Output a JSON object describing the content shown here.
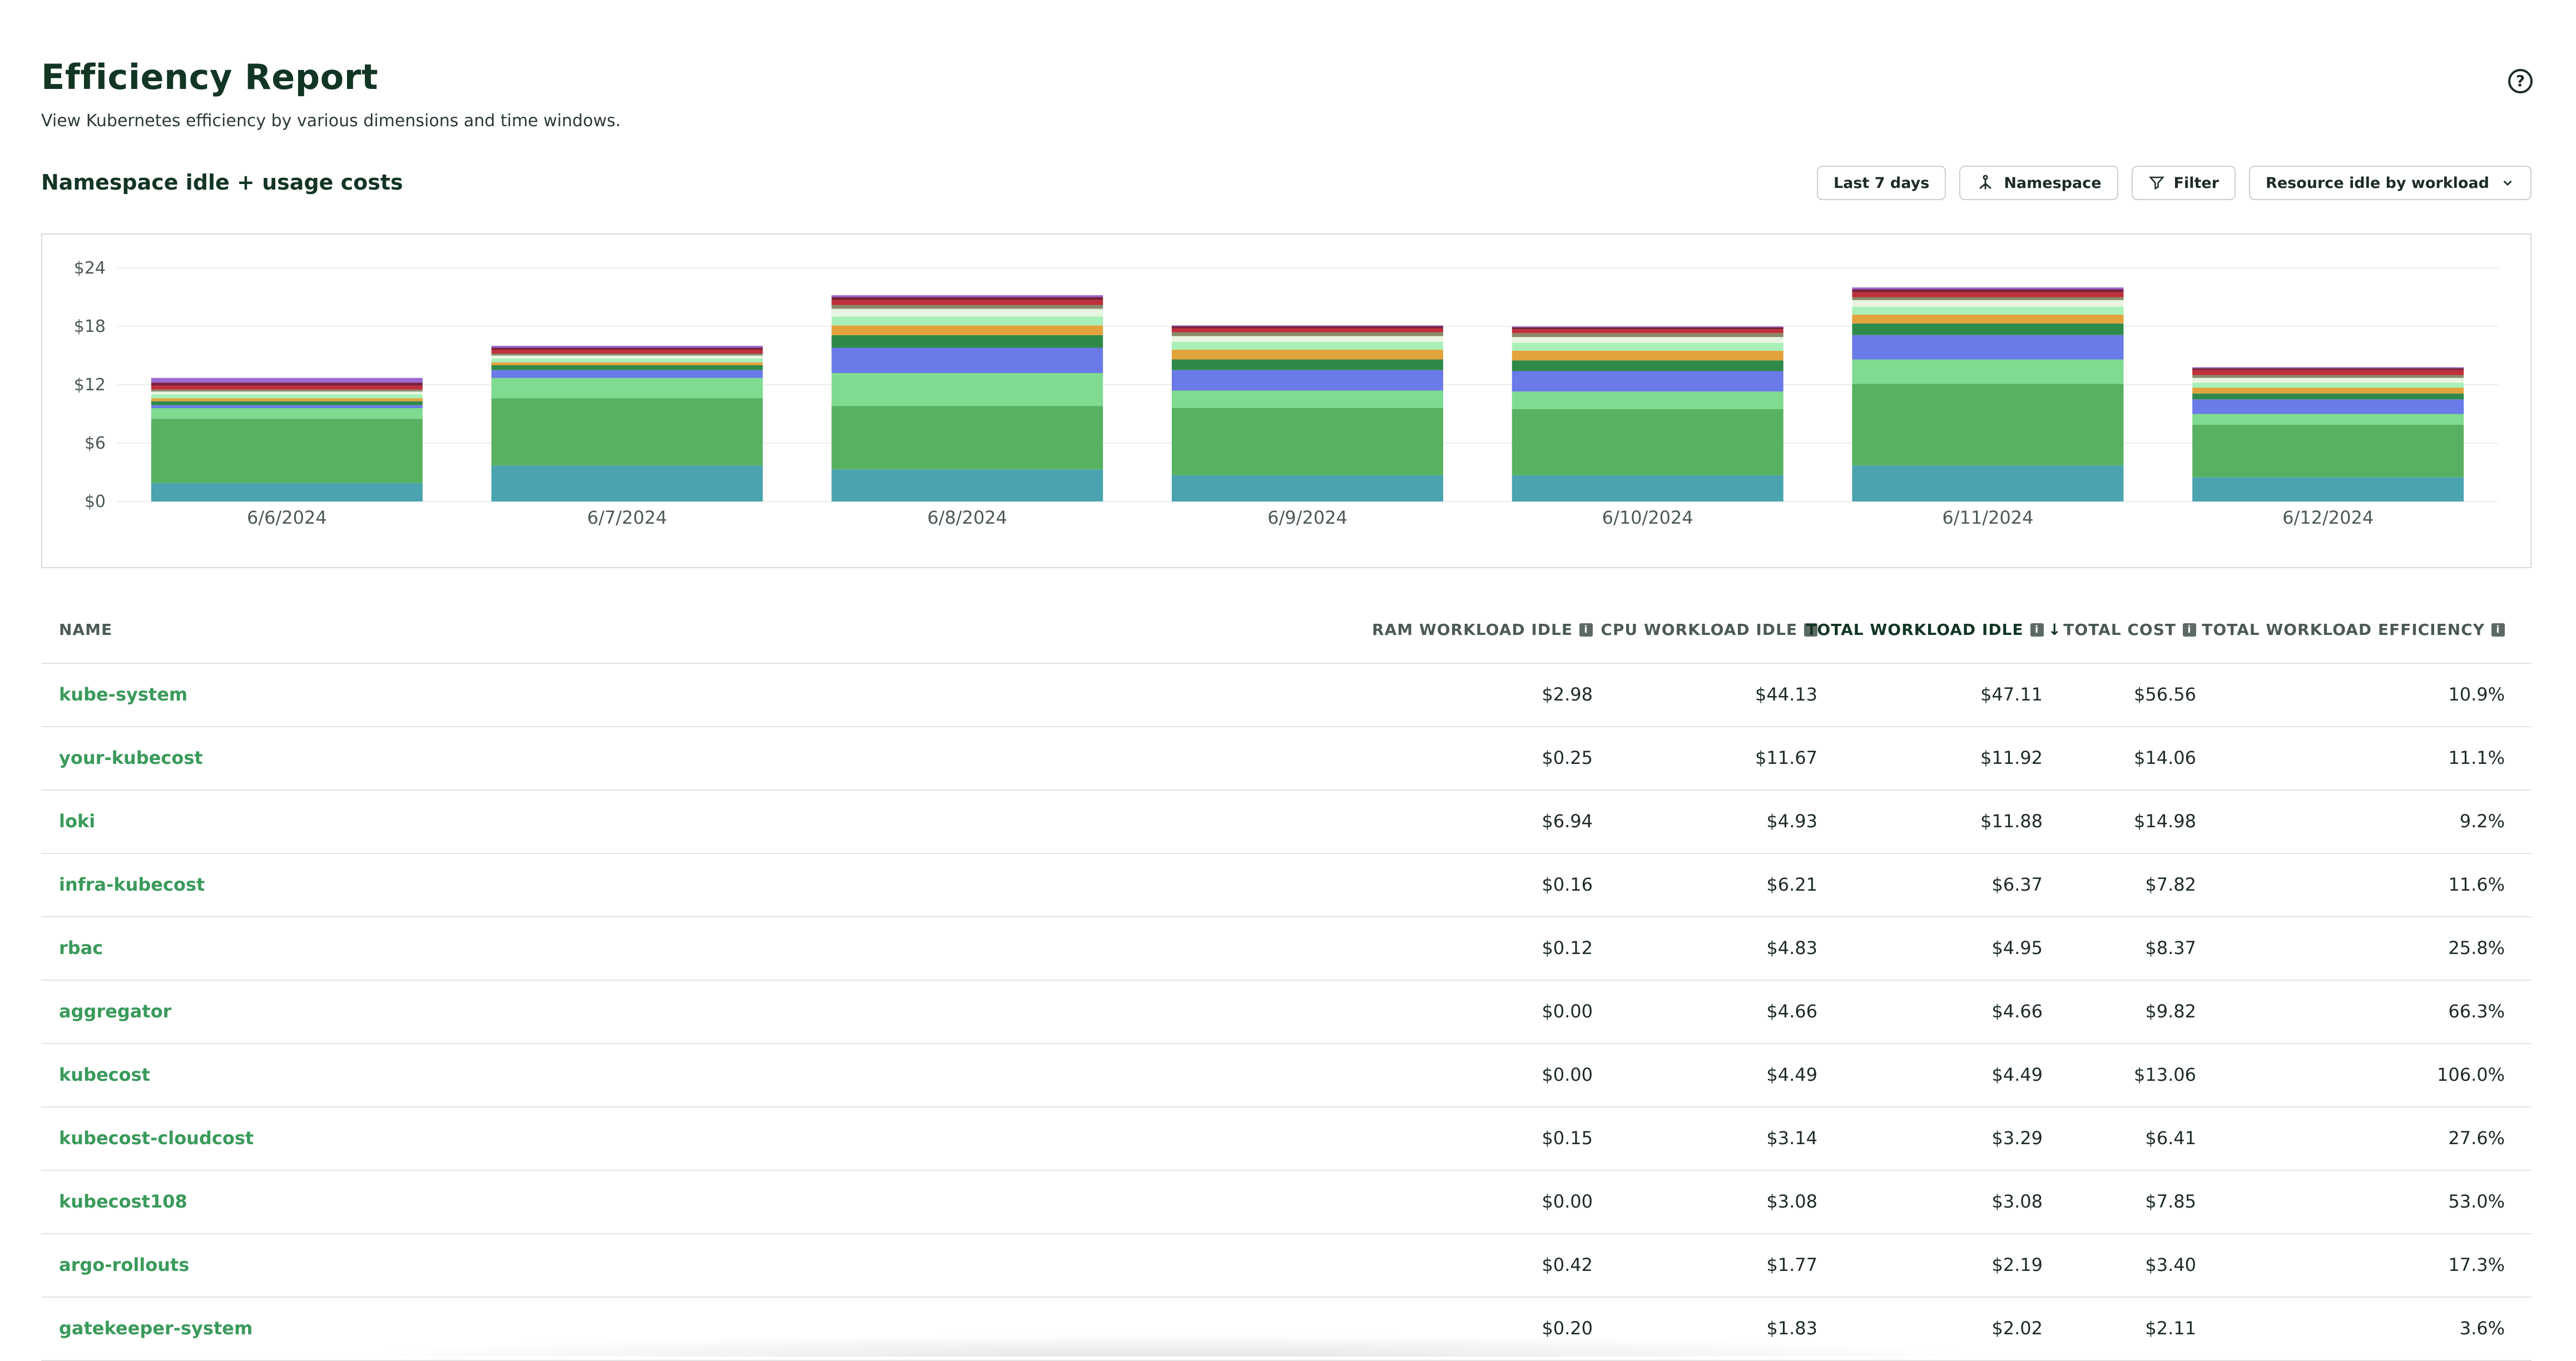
{
  "header": {
    "title": "Efficiency Report",
    "subtitle": "View Kubernetes efficiency by various dimensions and time windows.",
    "help_icon": "question-circle-icon"
  },
  "section": {
    "title": "Namespace idle + usage costs"
  },
  "toolbar": {
    "date_range": "Last 7 days",
    "aggregate": "Namespace",
    "filter": "Filter",
    "view": "Resource idle by workload"
  },
  "chart_data": {
    "type": "bar",
    "stacked": true,
    "categories": [
      "6/6/2024",
      "6/7/2024",
      "6/8/2024",
      "6/9/2024",
      "6/10/2024",
      "6/11/2024",
      "6/12/2024"
    ],
    "yticks": [
      "$24",
      "$18",
      "$12",
      "$6",
      "$0"
    ],
    "ylim": [
      0,
      24
    ],
    "grid": true,
    "colors": [
      "#4aa3ae",
      "#57b160",
      "#7edb8f",
      "#6a7ae8",
      "#2f8a4a",
      "#e2a23c",
      "#a8f0b8",
      "#e8f5e0",
      "#8a8a6a",
      "#c0303a",
      "#7a1f3a",
      "#9b6bd0"
    ],
    "series": [
      {
        "values": [
          1.9,
          3.7,
          3.3,
          2.7,
          2.7,
          3.7,
          2.5
        ]
      },
      {
        "values": [
          6.6,
          6.9,
          6.5,
          6.9,
          6.8,
          8.4,
          5.4
        ]
      },
      {
        "values": [
          1.1,
          2.1,
          3.4,
          1.8,
          1.8,
          2.5,
          1.1
        ]
      },
      {
        "values": [
          0.3,
          0.8,
          2.6,
          2.1,
          2.1,
          2.5,
          1.5
        ]
      },
      {
        "values": [
          0.4,
          0.5,
          1.3,
          1.1,
          1.1,
          1.2,
          0.6
        ]
      },
      {
        "values": [
          0.3,
          0.3,
          1.0,
          1.0,
          1.0,
          0.9,
          0.6
        ]
      },
      {
        "values": [
          0.4,
          0.4,
          0.9,
          0.8,
          0.8,
          0.8,
          0.5
        ]
      },
      {
        "values": [
          0.3,
          0.3,
          0.8,
          0.6,
          0.6,
          0.7,
          0.5
        ]
      },
      {
        "values": [
          0.2,
          0.2,
          0.4,
          0.4,
          0.4,
          0.3,
          0.3
        ]
      },
      {
        "values": [
          0.4,
          0.4,
          0.5,
          0.4,
          0.4,
          0.5,
          0.5
        ]
      },
      {
        "values": [
          0.3,
          0.2,
          0.3,
          0.2,
          0.2,
          0.3,
          0.2
        ]
      },
      {
        "values": [
          0.5,
          0.2,
          0.2,
          0.1,
          0.1,
          0.2,
          0.1
        ]
      }
    ]
  },
  "table": {
    "columns": {
      "name": "NAME",
      "ram": "RAM WORKLOAD IDLE",
      "cpu": "CPU WORKLOAD IDLE",
      "total_idle": "TOTAL WORKLOAD IDLE",
      "total_cost": "TOTAL COST",
      "efficiency": "TOTAL WORKLOAD EFFICIENCY"
    },
    "info_icon": "info-icon",
    "sort_icon": "arrow-down-icon",
    "rows": [
      {
        "name": "kube-system",
        "ram": "$2.98",
        "cpu": "$44.13",
        "total_idle": "$47.11",
        "total_cost": "$56.56",
        "efficiency": "10.9%"
      },
      {
        "name": "your-kubecost",
        "ram": "$0.25",
        "cpu": "$11.67",
        "total_idle": "$11.92",
        "total_cost": "$14.06",
        "efficiency": "11.1%"
      },
      {
        "name": "loki",
        "ram": "$6.94",
        "cpu": "$4.93",
        "total_idle": "$11.88",
        "total_cost": "$14.98",
        "efficiency": "9.2%"
      },
      {
        "name": "infra-kubecost",
        "ram": "$0.16",
        "cpu": "$6.21",
        "total_idle": "$6.37",
        "total_cost": "$7.82",
        "efficiency": "11.6%"
      },
      {
        "name": "rbac",
        "ram": "$0.12",
        "cpu": "$4.83",
        "total_idle": "$4.95",
        "total_cost": "$8.37",
        "efficiency": "25.8%"
      },
      {
        "name": "aggregator",
        "ram": "$0.00",
        "cpu": "$4.66",
        "total_idle": "$4.66",
        "total_cost": "$9.82",
        "efficiency": "66.3%"
      },
      {
        "name": "kubecost",
        "ram": "$0.00",
        "cpu": "$4.49",
        "total_idle": "$4.49",
        "total_cost": "$13.06",
        "efficiency": "106.0%"
      },
      {
        "name": "kubecost-cloudcost",
        "ram": "$0.15",
        "cpu": "$3.14",
        "total_idle": "$3.29",
        "total_cost": "$6.41",
        "efficiency": "27.6%"
      },
      {
        "name": "kubecost108",
        "ram": "$0.00",
        "cpu": "$3.08",
        "total_idle": "$3.08",
        "total_cost": "$7.85",
        "efficiency": "53.0%"
      },
      {
        "name": "argo-rollouts",
        "ram": "$0.42",
        "cpu": "$1.77",
        "total_idle": "$2.19",
        "total_cost": "$3.40",
        "efficiency": "17.3%"
      },
      {
        "name": "gatekeeper-system",
        "ram": "$0.20",
        "cpu": "$1.83",
        "total_idle": "$2.02",
        "total_cost": "$2.11",
        "efficiency": "3.6%"
      }
    ]
  }
}
